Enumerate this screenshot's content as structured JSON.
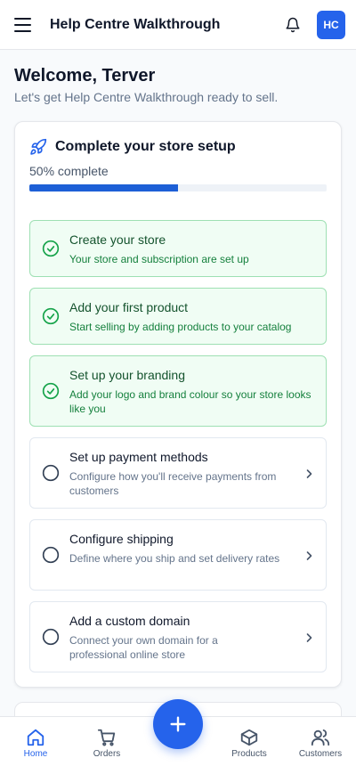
{
  "header": {
    "title": "Help Centre Walkthrough",
    "avatar_initials": "HC"
  },
  "welcome": {
    "heading": "Welcome, Terver",
    "subtext": "Let's get Help Centre Walkthrough ready to sell."
  },
  "setup": {
    "title": "Complete your store setup",
    "progress_label": "50% complete",
    "progress_fraction": 0.5,
    "tasks": [
      {
        "title": "Create your store",
        "description": "Your store and subscription are set up",
        "completed": true
      },
      {
        "title": "Add your first product",
        "description": "Start selling by adding products to your catalog",
        "completed": true
      },
      {
        "title": "Set up your branding",
        "description": "Add your logo and brand colour so your store looks like you",
        "completed": true
      },
      {
        "title": "Set up payment methods",
        "description": "Configure how you'll receive payments from customers",
        "completed": false
      },
      {
        "title": "Configure shipping",
        "description": "Define where you ship and set delivery rates",
        "completed": false
      },
      {
        "title": "Add a custom domain",
        "description": "Connect your own domain for a professional online store",
        "completed": false
      }
    ]
  },
  "nav": {
    "home": "Home",
    "orders": "Orders",
    "products": "Products",
    "customers": "Customers"
  },
  "colors": {
    "accent": "#2563eb",
    "success": "#16a34a",
    "success_bg": "#f0fdf4"
  },
  "icons": {
    "menu": "menu-icon",
    "notifications": "bell-icon",
    "setup": "rocket-icon",
    "done": "check-circle-icon",
    "todo": "empty-circle-icon",
    "next": "chevron-right-icon",
    "add": "plus-icon"
  }
}
